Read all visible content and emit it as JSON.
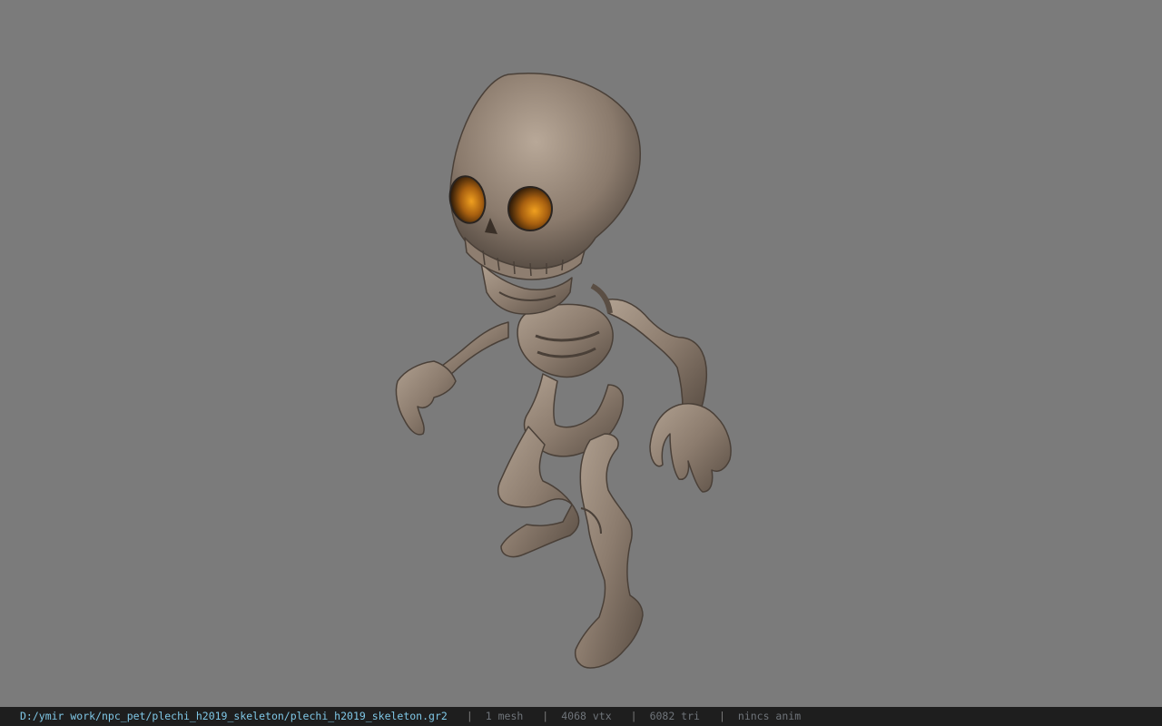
{
  "viewer": {
    "background_color": "#7b7b7b",
    "model_name": "plechi_h2019_skeleton"
  },
  "statusbar": {
    "path": "D:/ymir work/npc_pet/plechi_h2019_skeleton/plechi_h2019_skeleton.gr2",
    "separator": "|",
    "mesh_count": "1 mesh",
    "vertex_count": "4068 vtx",
    "triangle_count": "6082 tri",
    "anim_status": "nincs anim"
  },
  "colors": {
    "bone": "#9a8a7c",
    "bone_shadow": "#5e5248",
    "eye_glow": "#c07a10",
    "statusbar_bg": "#1e1e1e",
    "path_text": "#7fc7e6"
  }
}
